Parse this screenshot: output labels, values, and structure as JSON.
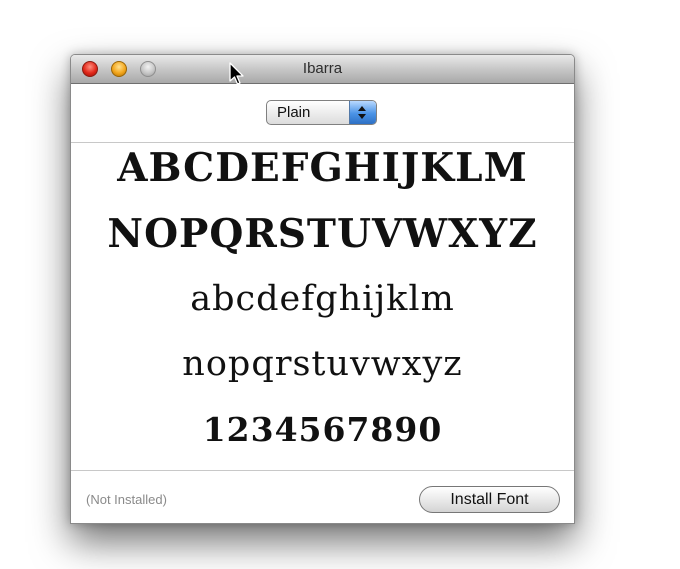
{
  "window": {
    "title": "Ibarra",
    "style_select": {
      "selected": "Plain"
    },
    "preview": {
      "uppercase_1": "ABCDEFGHIJKLM",
      "uppercase_2": "NOPQRSTUVWXYZ",
      "lowercase_1": "abcdefghijklm",
      "lowercase_2": "nopqrstuvwxyz",
      "digits": "1234567890"
    },
    "footer": {
      "status": "(Not Installed)",
      "install_label": "Install Font"
    }
  },
  "colors": {
    "close": "#e1281a",
    "minimize": "#f3a61c",
    "zoom": "#c7c7c7",
    "select_arrows": "#4a93e6",
    "status_text": "#8a8a8a"
  },
  "icons": {
    "pointer": "mouse-pointer-icon"
  }
}
